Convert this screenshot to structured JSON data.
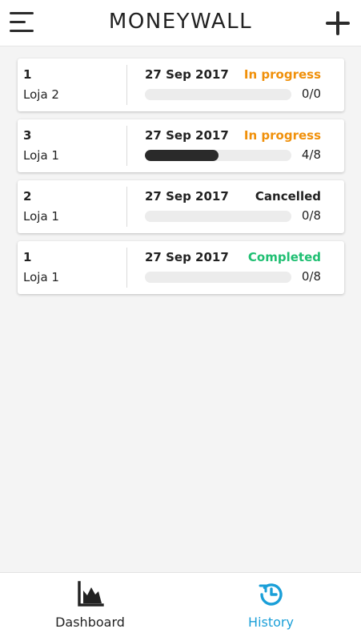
{
  "header": {
    "title": "MONEYWALL",
    "menu_icon": "hamburger-menu-icon",
    "add_icon": "plus-icon"
  },
  "orders": [
    {
      "quantity": "1",
      "store": "Loja 2",
      "date": "27 Sep 2017",
      "status": "In progress",
      "status_color": "#f0900a",
      "progress_text": "0/0",
      "progress_fraction": 0
    },
    {
      "quantity": "3",
      "store": "Loja 1",
      "date": "27 Sep 2017",
      "status": "In progress",
      "status_color": "#f0900a",
      "progress_text": "4/8",
      "progress_fraction": 0.5
    },
    {
      "quantity": "2",
      "store": "Loja 1",
      "date": "27 Sep 2017",
      "status": "Cancelled",
      "status_color": "#222222",
      "progress_text": "0/8",
      "progress_fraction": 0
    },
    {
      "quantity": "1",
      "store": "Loja 1",
      "date": "27 Sep 2017",
      "status": "Completed",
      "status_color": "#1fbf72",
      "progress_text": "0/8",
      "progress_fraction": 0
    }
  ],
  "bottom_nav": {
    "dashboard": {
      "label": "Dashboard",
      "icon": "area-chart-icon",
      "color": "#222222",
      "active": false
    },
    "history": {
      "label": "History",
      "icon": "history-icon",
      "color": "#1a9fd8",
      "active": true
    }
  },
  "colors": {
    "background": "#f4f4f4",
    "progress_track": "#ececec",
    "progress_fill": "#2a2a2a"
  }
}
